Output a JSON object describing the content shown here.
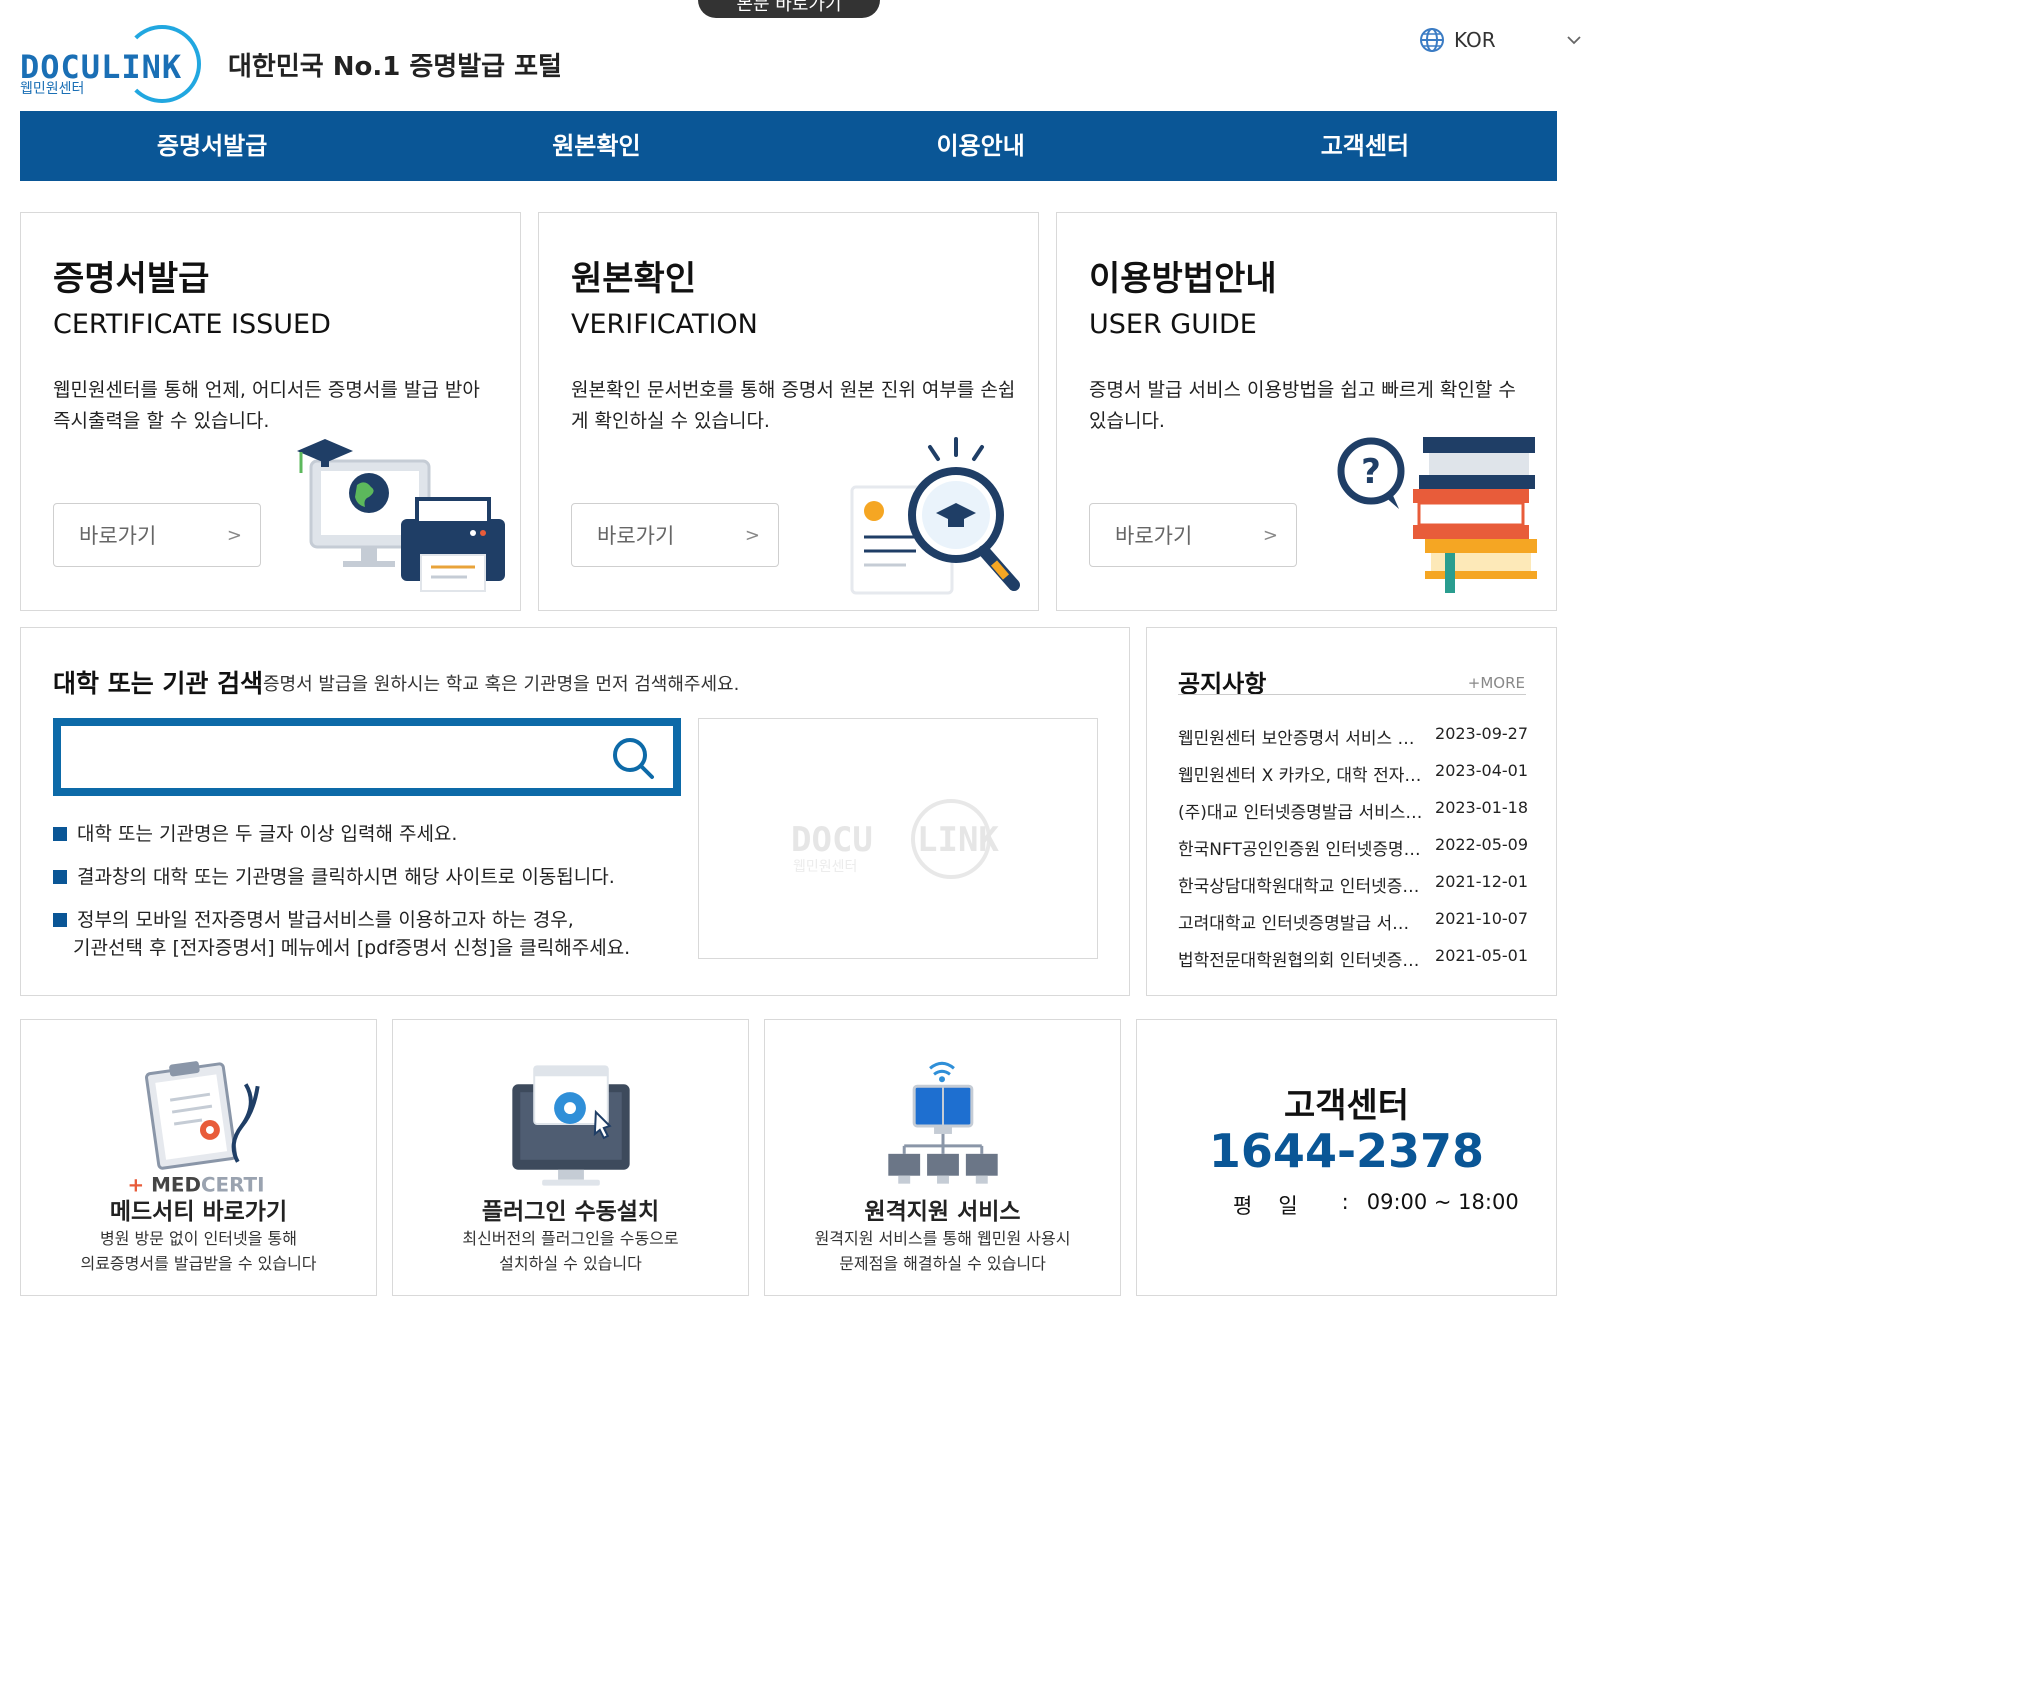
{
  "skip_link": "본문 바로가기",
  "header": {
    "logo_text_a": "DOCU",
    "logo_text_b": "LINK",
    "logo_sub": "웹민원센터",
    "tagline": "대한민국 No.1 증명발급 포털",
    "language": "KOR"
  },
  "nav": [
    "증명서발급",
    "원본확인",
    "이용안내",
    "고객센터"
  ],
  "cards": [
    {
      "title": "증명서발급",
      "subtitle": "CERTIFICATE ISSUED",
      "desc": "웹민원센터를 통해 언제, 어디서든 증명서를 발급 받아 즉시출력을 할 수 있습니다.",
      "button": "바로가기",
      "button_arrow": ">",
      "icon": "computer-printer-icon"
    },
    {
      "title": "원본확인",
      "subtitle": "VERIFICATION",
      "desc": "원본확인 문서번호를 통해 증명서 원본 진위 여부를 손쉽게 확인하실 수 있습니다.",
      "button": "바로가기",
      "button_arrow": ">",
      "icon": "certificate-magnifier-icon"
    },
    {
      "title": "이용방법안내",
      "subtitle": "USER GUIDE",
      "desc": "증명서 발급 서비스 이용방법을 쉽고 빠르게 확인할 수 있습니다.",
      "button": "바로가기",
      "button_arrow": ">",
      "icon": "question-books-icon"
    }
  ],
  "search": {
    "title": "대학 또는 기관 검색",
    "desc": "증명서 발급을 원하시는 학교 혹은 기관명을 먼저 검색해주세요.",
    "placeholder": "",
    "value": "",
    "tips": [
      "대학 또는 기관명은 두 글자 이상 입력해 주세요.",
      "결과창의 대학 또는 기관명을 클릭하시면 해당 사이트로 이동됩니다.",
      "정부의 모바일 전자증명서 발급서비스를 이용하고자 하는 경우,"
    ],
    "tip3_line2": "기관선택 후 [전자증명서] 메뉴에서 [pdf증명서 신청]을 클릭해주세요.",
    "ghost_logo_a": "DOCU",
    "ghost_logo_b": "LINK",
    "ghost_logo_sub": "웹민원센터"
  },
  "notice": {
    "title": "공지사항",
    "more": "+MORE",
    "items": [
      {
        "title": "웹민원센터 보안증명서 서비스 오픈 안내",
        "date": "2023-09-27"
      },
      {
        "title": "웹민원센터 X 카카오, 대학 전자증명서 발급 안내",
        "date": "2023-04-01"
      },
      {
        "title": "(주)대교 인터넷증명발급 서비스 오픈 안내",
        "date": "2023-01-18"
      },
      {
        "title": "한국NFT공인인증원 인터넷증명발급 서비스 오픈 안내",
        "date": "2022-05-09"
      },
      {
        "title": "한국상담대학원대학교 인터넷증명발급 서비스 오픈 안내",
        "date": "2021-12-01"
      },
      {
        "title": "고려대학교 인터넷증명발급 서비스 오픈 안내",
        "date": "2021-10-07"
      },
      {
        "title": "법학전문대학원협의회 인터넷증명발급 서비스 오픈 안내",
        "date": "2021-05-01"
      }
    ]
  },
  "boxes": [
    {
      "title": "메드서티 바로가기",
      "line1": "병원 방문 없이 인터넷을 통해",
      "line2": "의료증명서를 발급받을 수 있습니다",
      "brand_a": "MED",
      "brand_b": "CERTI",
      "icon": "clipboard-stethoscope-icon"
    },
    {
      "title": "플러그인 수동설치",
      "line1": "최신버전의 플러그인을 수동으로",
      "line2": "설치하실 수 있습니다",
      "icon": "monitor-gear-icon"
    },
    {
      "title": "원격지원 서비스",
      "line1": "원격지원 서비스를 통해 웹민원 사용시",
      "line2": "문제점을 해결하실 수 있습니다",
      "icon": "network-wifi-icon"
    }
  ],
  "customer_center": {
    "title": "고객센터",
    "phone": "1644-2378",
    "hours_label": "평일",
    "hours_sep": ":",
    "hours": "09:00 ~ 18:00"
  },
  "colors": {
    "brand_blue": "#0a5696",
    "accent_blue": "#21a7e0",
    "nav_bg": "#0a5696"
  }
}
